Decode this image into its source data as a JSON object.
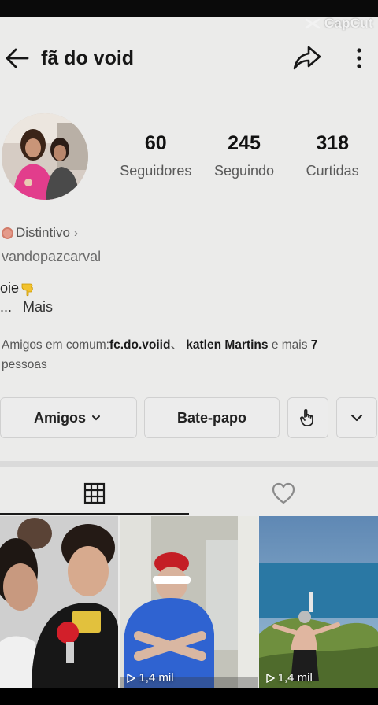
{
  "watermark": {
    "text": "CapCut"
  },
  "header": {
    "title": "fã do void"
  },
  "profile": {
    "stats": [
      {
        "value": "60",
        "label": "Seguidores"
      },
      {
        "value": "245",
        "label": "Seguindo"
      },
      {
        "value": "318",
        "label": "Curtidas"
      }
    ],
    "badge_label": "Distintivo",
    "handle": "vandopazcarval",
    "bio_text": "oie",
    "more_ellipsis": "...",
    "more_label": "Mais",
    "mutual": {
      "prefix": "Amigos em comum:",
      "friend1": "fc.do.voiid",
      "separator": "、",
      "friend2": "katlen Martins",
      "middle": " e mais ",
      "count": "7",
      "suffix": "pessoas"
    }
  },
  "actions": {
    "friends_label": "Amigos",
    "chat_label": "Bate-papo"
  },
  "videos": [
    {
      "views": ""
    },
    {
      "views": "1,4 mil"
    },
    {
      "views": "1,4 mil"
    }
  ],
  "icons": {
    "back": "arrow-left-icon",
    "share": "share-arrow-icon",
    "more": "more-vertical-icon",
    "grid": "grid-icon",
    "likes": "heart-icon"
  }
}
